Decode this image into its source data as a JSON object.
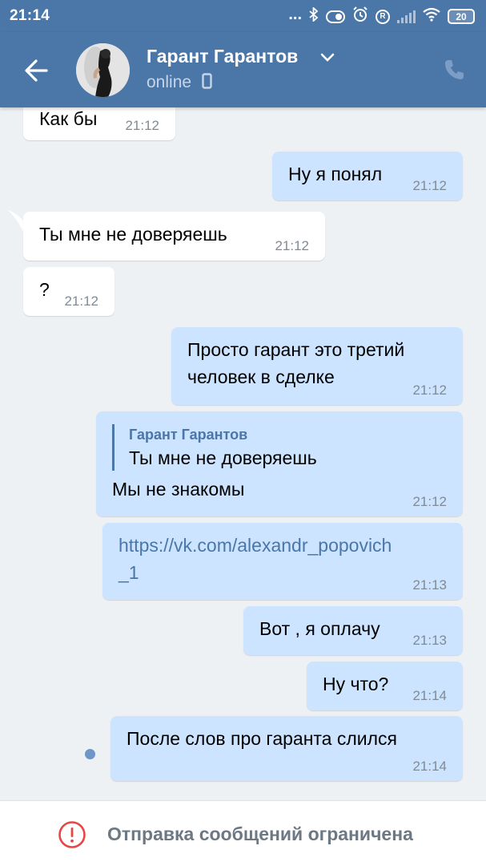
{
  "status_bar": {
    "time": "21:14",
    "dots": "...",
    "battery": "20"
  },
  "header": {
    "contact_name": "Гарант Гарантов",
    "status": "online",
    "icons": [
      "back-arrow-icon",
      "chevron-down-icon",
      "mobile-device-icon",
      "phone-icon"
    ]
  },
  "messages": [
    {
      "dir": "in",
      "text": "Как бы",
      "time": "21:12"
    },
    {
      "dir": "out",
      "text": "Ну я понял",
      "time": "21:12"
    },
    {
      "dir": "in",
      "text": "Ты мне не доверяешь",
      "time": "21:12"
    },
    {
      "dir": "in",
      "text": "?",
      "time": "21:12"
    },
    {
      "dir": "out",
      "lines": [
        "Просто гарант это третий",
        "человек в сделке"
      ],
      "time": "21:12"
    },
    {
      "dir": "out",
      "reply": {
        "name": "Гарант Гарантов",
        "text": "Ты мне не доверяешь"
      },
      "text": "Мы не знакомы",
      "time": "21:12"
    },
    {
      "dir": "out",
      "link_lines": [
        "https://vk.com/alexandr_popovich",
        "_1"
      ],
      "time": "21:13"
    },
    {
      "dir": "out",
      "text": "Вот , я оплачу",
      "time": "21:13"
    },
    {
      "dir": "out",
      "text": "Ну что?",
      "time": "21:14"
    },
    {
      "dir": "out",
      "text": "После слов про гаранта слился",
      "time": "21:14",
      "unread": true
    }
  ],
  "bottom_bar": {
    "text": "Отправка сообщений ограничена",
    "icon": "exclamation-circle-icon"
  },
  "colors": {
    "header": "#4a76a8",
    "incoming_bubble": "#ffffff",
    "outgoing_bubble": "#cce4ff",
    "background": "#eef1f4",
    "warning": "#e64646"
  }
}
